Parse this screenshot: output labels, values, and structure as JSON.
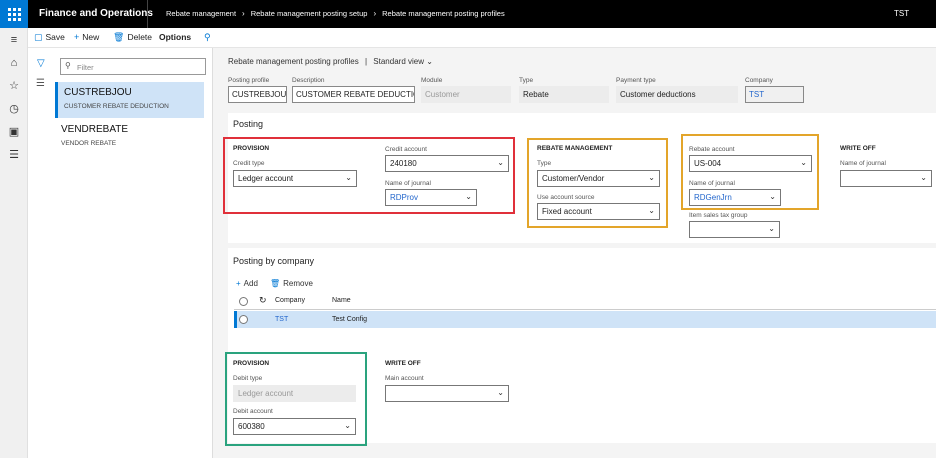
{
  "app": {
    "title": "Finance and Operations",
    "company": "TST"
  },
  "breadcrumb": [
    "Rebate management",
    "Rebate management posting setup",
    "Rebate management posting profiles"
  ],
  "actions": {
    "save": "Save",
    "new": "New",
    "delete": "Delete",
    "options": "Options"
  },
  "list": {
    "filter_placeholder": "Filter",
    "records": [
      {
        "title": "CUSTREBJOU",
        "subtitle": "CUSTOMER REBATE DEDUCTION"
      },
      {
        "title": "VENDREBATE",
        "subtitle": "VENDOR REBATE"
      }
    ]
  },
  "header": {
    "title": "Rebate management posting profiles",
    "view": "Standard view",
    "separator": "|",
    "fields": {
      "posting_profile": {
        "label": "Posting profile",
        "value": "CUSTREBJOU"
      },
      "description": {
        "label": "Description",
        "value": "CUSTOMER REBATE DEDUCTION"
      },
      "module": {
        "label": "Module",
        "value": "Customer"
      },
      "type": {
        "label": "Type",
        "value": "Rebate"
      },
      "payment_type": {
        "label": "Payment type",
        "value": "Customer deductions"
      },
      "company": {
        "label": "Company",
        "value": "TST"
      }
    }
  },
  "posting": {
    "title": "Posting",
    "provision": {
      "title": "PROVISION",
      "credit_type": {
        "label": "Credit type",
        "value": "Ledger account"
      },
      "credit_account": {
        "label": "Credit account",
        "value": "240180"
      },
      "name_of_journal": {
        "label": "Name of journal",
        "value": "RDProv"
      }
    },
    "rebate_management": {
      "title": "REBATE MANAGEMENT",
      "type": {
        "label": "Type",
        "value": "Customer/Vendor"
      },
      "use_account_source": {
        "label": "Use account source",
        "value": "Fixed account"
      }
    },
    "rebate": {
      "rebate_account": {
        "label": "Rebate account",
        "value": "US-004"
      },
      "name_of_journal": {
        "label": "Name of journal",
        "value": "RDGenJrn"
      },
      "item_sales_tax_group": {
        "label": "Item sales tax group",
        "value": ""
      }
    },
    "write_off": {
      "title": "WRITE OFF",
      "name_of_journal": {
        "label": "Name of journal",
        "value": ""
      }
    }
  },
  "posting_by_company": {
    "title": "Posting by company",
    "add": "Add",
    "remove": "Remove",
    "columns": {
      "company": "Company",
      "name": "Name"
    },
    "rows": [
      {
        "company": "TST",
        "name": "Test Config"
      }
    ],
    "provision": {
      "title": "PROVISION",
      "debit_type": {
        "label": "Debit type",
        "value": "Ledger account"
      },
      "debit_account": {
        "label": "Debit account",
        "value": "600380"
      }
    },
    "write_off": {
      "title": "WRITE OFF",
      "main_account": {
        "label": "Main account",
        "value": ""
      }
    }
  },
  "colors": {
    "accent": "#0078d4",
    "highlight_red": "#e0303a",
    "highlight_gold": "#e3a52a",
    "highlight_green": "#2aa37e"
  }
}
